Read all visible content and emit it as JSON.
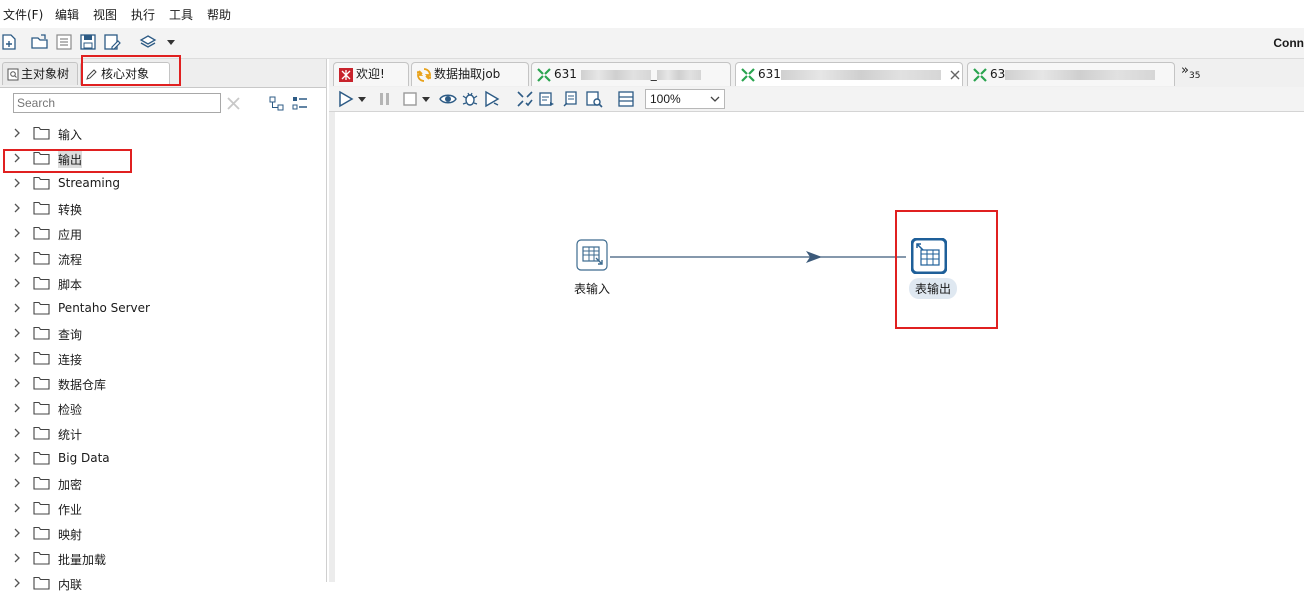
{
  "menu": {
    "file": "文件(F)",
    "edit": "编辑",
    "view": "视图",
    "run": "执行",
    "tools": "工具",
    "help": "帮助"
  },
  "toolbar": {
    "connect_label": "Conn"
  },
  "left_panel": {
    "tabs": {
      "tree": "主对象树",
      "core": "核心对象"
    },
    "search": {
      "placeholder": "Search"
    },
    "items": [
      {
        "label": "输入"
      },
      {
        "label": "输出"
      },
      {
        "label": "Streaming"
      },
      {
        "label": "转换"
      },
      {
        "label": "应用"
      },
      {
        "label": "流程"
      },
      {
        "label": "脚本"
      },
      {
        "label": "Pentaho Server"
      },
      {
        "label": "查询"
      },
      {
        "label": "连接"
      },
      {
        "label": "数据仓库"
      },
      {
        "label": "检验"
      },
      {
        "label": "统计"
      },
      {
        "label": "Big Data"
      },
      {
        "label": "加密"
      },
      {
        "label": "作业"
      },
      {
        "label": "映射"
      },
      {
        "label": "批量加载"
      },
      {
        "label": "内联"
      }
    ]
  },
  "doc_tabs": {
    "welcome": "欢迎!",
    "job": "数据抽取job",
    "t1_prefix": "631",
    "t1_suffix": "_",
    "t2_prefix": "631",
    "t3_prefix": "63",
    "overflow": "»",
    "overflow_count": "35"
  },
  "canvas_toolbar": {
    "zoom": "100%"
  },
  "canvas": {
    "step_input": "表输入",
    "step_output": "表输出"
  },
  "colors": {
    "highlight_red": "#e02020",
    "hop_line": "#3c5a7a",
    "step_blue": "#1e5f99"
  }
}
